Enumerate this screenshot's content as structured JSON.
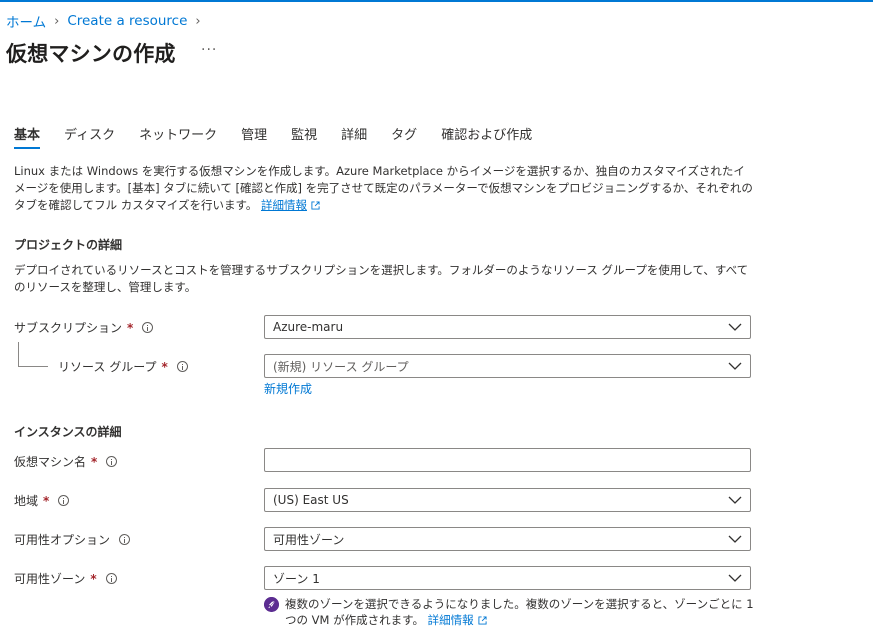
{
  "breadcrumb": {
    "home": "ホーム",
    "create_resource": "Create a resource"
  },
  "page": {
    "title": "仮想マシンの作成",
    "more": "···"
  },
  "tabs": [
    {
      "label": "基本",
      "active": true
    },
    {
      "label": "ディスク",
      "active": false
    },
    {
      "label": "ネットワーク",
      "active": false
    },
    {
      "label": "管理",
      "active": false
    },
    {
      "label": "監視",
      "active": false
    },
    {
      "label": "詳細",
      "active": false
    },
    {
      "label": "タグ",
      "active": false
    },
    {
      "label": "確認および作成",
      "active": false
    }
  ],
  "intro": {
    "text": "Linux または Windows を実行する仮想マシンを作成します。Azure Marketplace からイメージを選択するか、独自のカスタマイズされたイメージを使用します。[基本] タブに続いて [確認と作成] を完了させて既定のパラメーターで仮想マシンをプロビジョニングするか、それぞれのタブを確認してフル カスタマイズを行います。",
    "link": "詳細情報"
  },
  "project": {
    "title": "プロジェクトの詳細",
    "desc": "デプロイされているリソースとコストを管理するサブスクリプションを選択します。フォルダーのようなリソース グループを使用して、すべてのリソースを整理し、管理します。",
    "subscription_label": "サブスクリプション",
    "subscription_value": "Azure-maru",
    "resource_group_label": "リソース グループ",
    "resource_group_placeholder": "(新規) リソース グループ",
    "new_link": "新規作成"
  },
  "instance": {
    "title": "インスタンスの詳細",
    "vm_name_label": "仮想マシン名",
    "vm_name_value": "",
    "region_label": "地域",
    "region_value": "(US) East US",
    "availability_option_label": "可用性オプション",
    "availability_option_value": "可用性ゾーン",
    "availability_zone_label": "可用性ゾーン",
    "availability_zone_value": "ゾーン 1",
    "note_text": "複数のゾーンを選択できるようになりました。複数のゾーンを選択すると、ゾーンごとに 1 つの VM が作成されます。",
    "note_link": "詳細情報"
  },
  "required_mark": "*",
  "colors": {
    "accent": "#0078d4",
    "required": "#a4262c",
    "rocket": "#5c2d91"
  }
}
